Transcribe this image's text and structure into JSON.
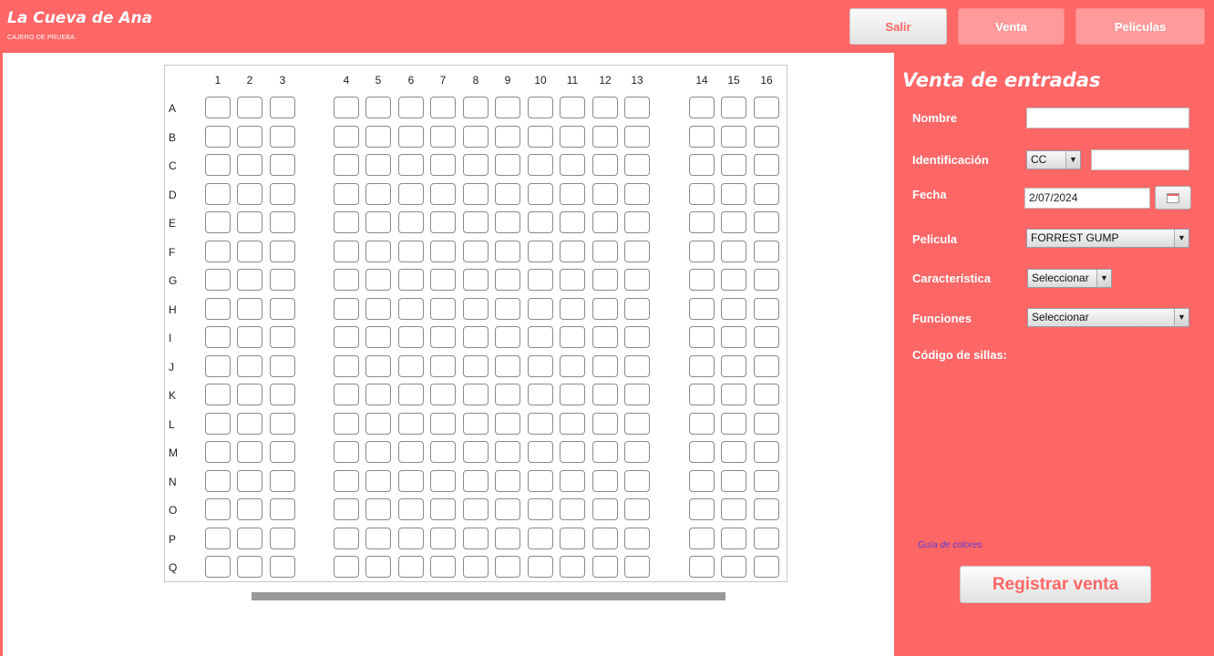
{
  "header": {
    "title": "La Cueva de Ana",
    "subtitle": "CAJERO DE PRUEBA",
    "buttons": {
      "salir": "Salir",
      "venta": "Venta",
      "peliculas": "Peliculas"
    }
  },
  "seats": {
    "columns": [
      "1",
      "2",
      "3",
      "4",
      "5",
      "6",
      "7",
      "8",
      "9",
      "10",
      "11",
      "12",
      "13",
      "14",
      "15",
      "16"
    ],
    "rows": [
      "A",
      "B",
      "C",
      "D",
      "E",
      "F",
      "G",
      "H",
      "I",
      "J",
      "K",
      "L",
      "M",
      "N",
      "O",
      "P",
      "Q"
    ]
  },
  "form": {
    "title": "Venta de entradas",
    "nombre_label": "Nombre",
    "nombre_value": "",
    "identificacion_label": "Identificación",
    "id_type": "CC",
    "id_value": "",
    "fecha_label": "Fecha",
    "fecha_value": "2/07/2024",
    "pelicula_label": "Pelicula",
    "pelicula_value": "FORREST GUMP",
    "caracteristica_label": "Característica",
    "caracteristica_value": "Seleccionar",
    "funciones_label": "Funciones",
    "funciones_value": "Seleccionar",
    "codigo_label": "Código de sillas:",
    "guia_link": "Guía de colores",
    "registrar_button": "Registrar venta"
  },
  "colors": {
    "accent": "#ff6666",
    "accent_light": "#ff9a9a",
    "link": "#5a3ad8"
  },
  "icons": {
    "calendar": "calendar-icon",
    "dropdown": "chevron-down-icon"
  }
}
